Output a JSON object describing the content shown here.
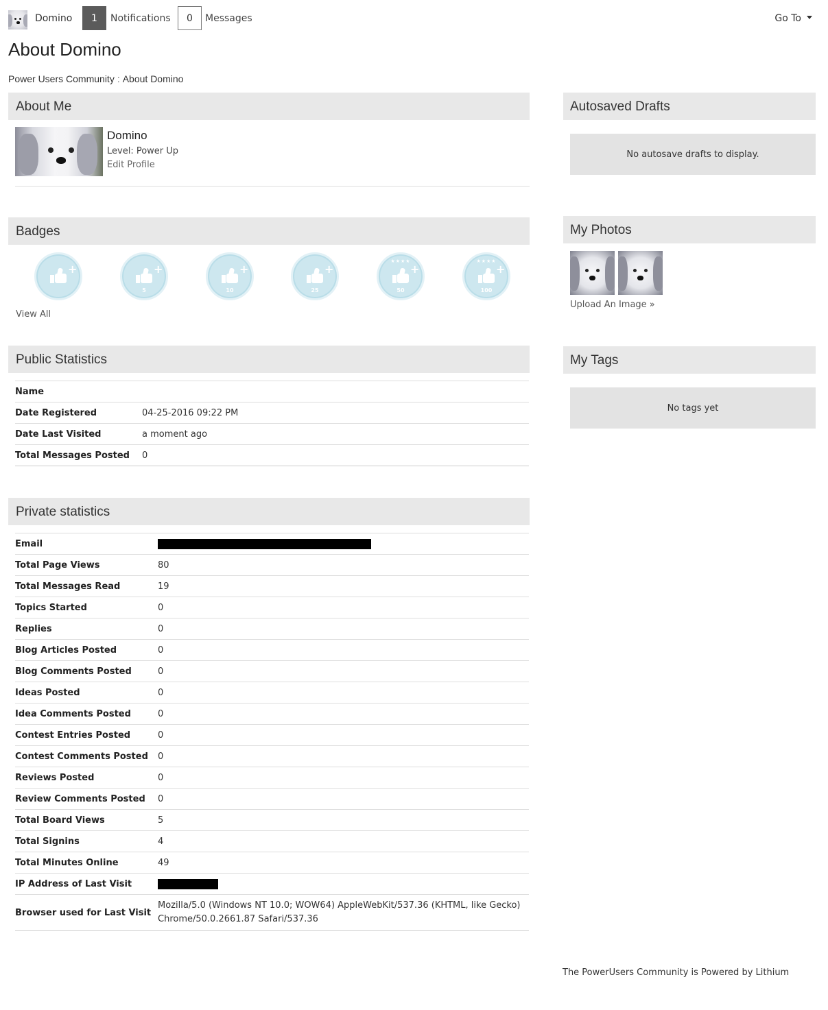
{
  "topbar": {
    "username": "Domino",
    "notifications_count": "1",
    "notifications_label": "Notifications",
    "messages_count": "0",
    "messages_label": "Messages",
    "goto_label": "Go To"
  },
  "page": {
    "title": "About Domino",
    "breadcrumb": [
      "Power Users Community",
      "About Domino"
    ]
  },
  "about": {
    "heading": "About Me",
    "name": "Domino",
    "level": "Level: Power Up",
    "edit_link": "Edit Profile"
  },
  "badges": {
    "heading": "Badges",
    "items": [
      {
        "icon": "thumbs-up-badge-icon",
        "number": ""
      },
      {
        "icon": "thumbs-up-badge-icon",
        "number": "5"
      },
      {
        "icon": "thumbs-up-badge-icon",
        "number": "10"
      },
      {
        "icon": "thumbs-up-badge-icon",
        "number": "25"
      },
      {
        "icon": "thumbs-up-badge-icon",
        "number": "50"
      },
      {
        "icon": "thumbs-up-badge-icon",
        "number": "100"
      }
    ],
    "view_all": "View All"
  },
  "public_stats": {
    "heading": "Public Statistics",
    "rows": [
      {
        "label": "Name",
        "value": ""
      },
      {
        "label": "Date Registered",
        "value": "04-25-2016 09:22 PM"
      },
      {
        "label": "Date Last Visited",
        "value": "a moment ago"
      },
      {
        "label": "Total Messages Posted",
        "value": "0"
      }
    ]
  },
  "private_stats": {
    "heading": "Private statistics",
    "rows": [
      {
        "label": "Email",
        "value": "",
        "redacted": true
      },
      {
        "label": "Total Page Views",
        "value": "80"
      },
      {
        "label": "Total Messages Read",
        "value": "19"
      },
      {
        "label": "Topics Started",
        "value": "0"
      },
      {
        "label": "Replies",
        "value": "0"
      },
      {
        "label": "Blog Articles Posted",
        "value": "0"
      },
      {
        "label": "Blog Comments Posted",
        "value": "0"
      },
      {
        "label": "Ideas Posted",
        "value": "0"
      },
      {
        "label": "Idea Comments Posted",
        "value": "0"
      },
      {
        "label": "Contest Entries Posted",
        "value": "0"
      },
      {
        "label": "Contest Comments Posted",
        "value": "0"
      },
      {
        "label": "Reviews Posted",
        "value": "0"
      },
      {
        "label": "Review Comments Posted",
        "value": "0"
      },
      {
        "label": "Total Board Views",
        "value": "5"
      },
      {
        "label": "Total Signins",
        "value": "4"
      },
      {
        "label": "Total Minutes Online",
        "value": "49"
      },
      {
        "label": "IP Address of Last Visit",
        "value": "",
        "redacted": true
      },
      {
        "label": "Browser used for Last Visit",
        "value": "Mozilla/5.0 (Windows NT 10.0; WOW64) AppleWebKit/537.36 (KHTML, like Gecko) Chrome/50.0.2661.87 Safari/537.36"
      }
    ]
  },
  "drafts": {
    "heading": "Autosaved Drafts",
    "empty_text": "No autosave drafts to display."
  },
  "photos": {
    "heading": "My Photos",
    "upload_link": "Upload An Image »"
  },
  "tags": {
    "heading": "My Tags",
    "empty_text": "No tags yet"
  },
  "footer": {
    "text": "The PowerUsers Community is Powered by Lithium"
  },
  "colors": {
    "panel_header_bg": "#e8e8e8",
    "badge_fill": "#cde7ef",
    "notification_box": "#5b5b5b"
  }
}
